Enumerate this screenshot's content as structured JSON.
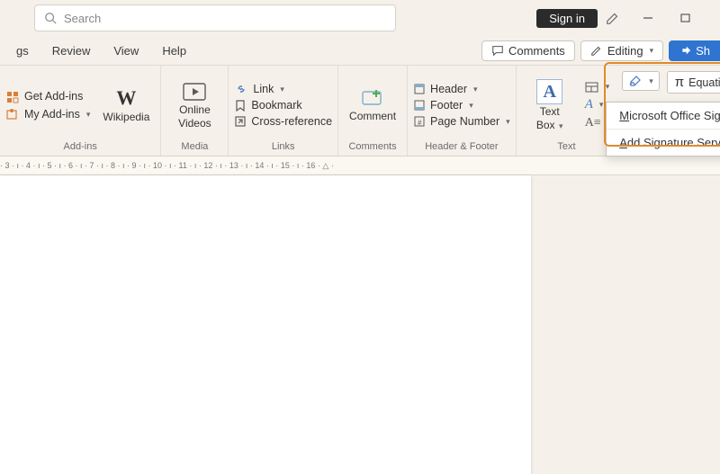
{
  "titlebar": {
    "search_placeholder": "Search",
    "signin": "Sign in"
  },
  "tabs": {
    "partial": "gs",
    "review": "Review",
    "view": "View",
    "help": "Help"
  },
  "actions": {
    "comments": "Comments",
    "editing": "Editing",
    "share": "Sh"
  },
  "ribbon": {
    "addins": {
      "get": "Get Add-ins",
      "my": "My Add-ins",
      "wikipedia": "Wikipedia",
      "label": "Add-ins"
    },
    "media": {
      "online_videos_l1": "Online",
      "online_videos_l2": "Videos",
      "label": "Media"
    },
    "links": {
      "link": "Link",
      "bookmark": "Bookmark",
      "crossref": "Cross-reference",
      "label": "Links"
    },
    "comments": {
      "comment": "Comment",
      "label": "Comments"
    },
    "hf": {
      "header": "Header",
      "footer": "Footer",
      "page_number": "Page Number",
      "label": "Header & Footer"
    },
    "text": {
      "textbox_l1": "Text",
      "textbox_l2": "Box",
      "label": "Text"
    },
    "symbols": {
      "equation": "Equation"
    }
  },
  "dropdown": {
    "ms_sig": "Microsoft Office Signature",
    "add_sig": "Add Signature Services..."
  },
  "dropdown_underline": {
    "ms_first": "M",
    "add_first": "A"
  },
  "ruler": " · 3 · ı · 4 · ı · 5 · ı · 6 · ı · 7 · ı · 8 · ı · 9 · ı · 10 · ı · 11 · ı · 12 · ı · 13 · ı · 14 · ı · 15 · ı · 16 · △ ·"
}
